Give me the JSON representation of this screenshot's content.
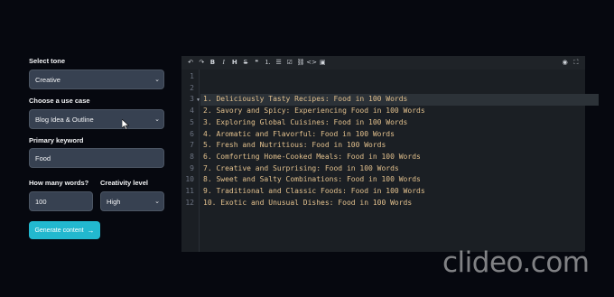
{
  "form": {
    "tone": {
      "label": "Select tone",
      "value": "Creative"
    },
    "use_case": {
      "label": "Choose a use case",
      "value": "Blog Idea & Outline"
    },
    "keyword": {
      "label": "Primary keyword",
      "value": "Food"
    },
    "words": {
      "label": "How many words?",
      "value": "100"
    },
    "creativity": {
      "label": "Creativity level",
      "value": "High"
    },
    "generate": {
      "label": "Generate content",
      "icon": "arrow-right-icon"
    }
  },
  "editor": {
    "toolbar_icons": [
      "undo-icon",
      "redo-icon",
      "bold-icon",
      "italic-icon",
      "heading-icon",
      "strikethrough-icon",
      "quote-icon",
      "ordered-list-icon",
      "unordered-list-icon",
      "checklist-icon",
      "link-icon",
      "code-icon",
      "image-icon",
      "eye-icon",
      "fullscreen-icon"
    ],
    "toolbar_glyphs": {
      "undo": "↶",
      "redo": "↷",
      "bold": "B",
      "italic": "I",
      "heading": "H",
      "strike": "S",
      "quote": "❝",
      "ol": "⒈",
      "ul": "☰",
      "check": "☑",
      "link": "⛓",
      "code": "<>",
      "image": "▣",
      "eye": "◉",
      "fullscreen": "⛶"
    },
    "line_numbers": [
      "1",
      "2",
      "3",
      "4",
      "5",
      "6",
      "7",
      "8",
      "9",
      "10",
      "11",
      "12"
    ],
    "lines": [
      "",
      "",
      "1. Deliciously Tasty Recipes: Food in 100 Words",
      "2. Savory and Spicy: Experiencing Food in 100 Words",
      "3. Exploring Global Cuisines: Food in 100 Words",
      "4. Aromatic and Flavorful: Food in 100 Words",
      "5. Fresh and Nutritious: Food in 100 Words",
      "6. Comforting Home-Cooked Meals: Food in 100 Words",
      "7. Creative and Surprising: Food in 100 Words",
      "8. Sweet and Salty Combinations: Food in 100 Words",
      "9. Traditional and Classic Foods: Food in 100 Words",
      "10. Exotic and Unusual Dishes: Food in 100 Words"
    ],
    "text_color": "#e2c08d"
  },
  "watermark": "clideo.com"
}
